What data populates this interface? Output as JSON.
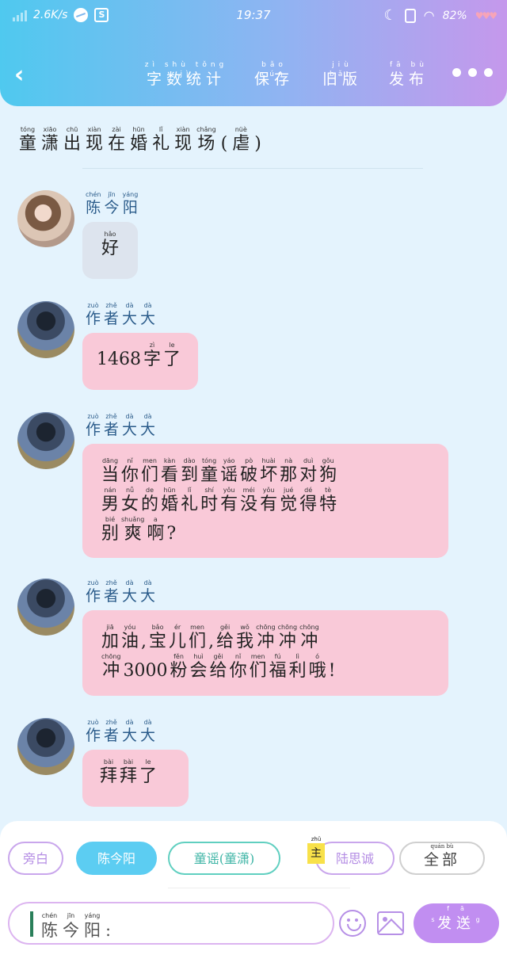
{
  "status_bar": {
    "speed": "2.6K/s",
    "s_icon": "S",
    "time": "19:37",
    "battery": "82%",
    "hearts": "♥♥♥"
  },
  "toolbar": {
    "back_icon": "‹",
    "items": [
      {
        "pinyin": "zì shù tǒng jì",
        "label": "字数统计"
      },
      {
        "pinyin": "bǎo cún",
        "label": "保存"
      },
      {
        "pinyin": "jiù bǎn",
        "label": "旧版"
      },
      {
        "pinyin": "fā bù",
        "label": "发布"
      }
    ]
  },
  "title": {
    "chars": [
      {
        "py": "tóng",
        "hz": "童"
      },
      {
        "py": "xiāo",
        "hz": "潇"
      },
      {
        "py": "chū",
        "hz": "出"
      },
      {
        "py": "xiàn",
        "hz": "现"
      },
      {
        "py": "zài",
        "hz": "在"
      },
      {
        "py": "hūn",
        "hz": "婚"
      },
      {
        "py": "lǐ",
        "hz": "礼"
      },
      {
        "py": "xiàn",
        "hz": "现"
      },
      {
        "py": "chǎng",
        "hz": "场"
      },
      {
        "py": "",
        "hz": "("
      },
      {
        "py": "nüè",
        "hz": "虐"
      },
      {
        "py": "",
        "hz": ")"
      }
    ]
  },
  "messages": [
    {
      "sender": [
        {
          "py": "chén",
          "hz": "陈"
        },
        {
          "py": "jīn",
          "hz": "今"
        },
        {
          "py": "yáng",
          "hz": "阳"
        }
      ],
      "lines": [
        [
          {
            "py": "hǎo",
            "hz": "好"
          }
        ]
      ]
    },
    {
      "sender": [
        {
          "py": "zuò",
          "hz": "作"
        },
        {
          "py": "zhě",
          "hz": "者"
        },
        {
          "py": "dà",
          "hz": "大"
        },
        {
          "py": "dà",
          "hz": "大"
        }
      ],
      "lines": [
        [
          {
            "py": "",
            "hz": "1468"
          },
          {
            "py": "zì",
            "hz": "字"
          },
          {
            "py": "le",
            "hz": "了"
          }
        ]
      ]
    },
    {
      "sender": [
        {
          "py": "zuò",
          "hz": "作"
        },
        {
          "py": "zhě",
          "hz": "者"
        },
        {
          "py": "dà",
          "hz": "大"
        },
        {
          "py": "dà",
          "hz": "大"
        }
      ],
      "lines": [
        [
          {
            "py": "dāng",
            "hz": "当"
          },
          {
            "py": "nǐ",
            "hz": "你"
          },
          {
            "py": "men",
            "hz": "们"
          },
          {
            "py": "kàn",
            "hz": "看"
          },
          {
            "py": "dào",
            "hz": "到"
          },
          {
            "py": "tóng",
            "hz": "童"
          },
          {
            "py": "yáo",
            "hz": "谣"
          },
          {
            "py": "pò",
            "hz": "破"
          },
          {
            "py": "huài",
            "hz": "坏"
          },
          {
            "py": "nà",
            "hz": "那"
          },
          {
            "py": "duì",
            "hz": "对"
          },
          {
            "py": "gǒu",
            "hz": "狗"
          }
        ],
        [
          {
            "py": "nán",
            "hz": "男"
          },
          {
            "py": "nǚ",
            "hz": "女"
          },
          {
            "py": "de",
            "hz": "的"
          },
          {
            "py": "hūn",
            "hz": "婚"
          },
          {
            "py": "lǐ",
            "hz": "礼"
          },
          {
            "py": "shí",
            "hz": "时"
          },
          {
            "py": "yǒu",
            "hz": "有"
          },
          {
            "py": "méi",
            "hz": "没"
          },
          {
            "py": "yǒu",
            "hz": "有"
          },
          {
            "py": "jué",
            "hz": "觉"
          },
          {
            "py": "dé",
            "hz": "得"
          },
          {
            "py": "tè",
            "hz": "特"
          }
        ],
        [
          {
            "py": "bié",
            "hz": "别"
          },
          {
            "py": "shuǎng",
            "hz": "爽"
          },
          {
            "py": "a",
            "hz": "啊"
          },
          {
            "py": "",
            "hz": "?"
          }
        ]
      ]
    },
    {
      "sender": [
        {
          "py": "zuò",
          "hz": "作"
        },
        {
          "py": "zhě",
          "hz": "者"
        },
        {
          "py": "dà",
          "hz": "大"
        },
        {
          "py": "dà",
          "hz": "大"
        }
      ],
      "lines": [
        [
          {
            "py": "jiā",
            "hz": "加"
          },
          {
            "py": "yóu",
            "hz": "油"
          },
          {
            "py": "",
            "hz": ","
          },
          {
            "py": "bǎo",
            "hz": "宝"
          },
          {
            "py": "ér",
            "hz": "儿"
          },
          {
            "py": "men",
            "hz": "们"
          },
          {
            "py": "",
            "hz": ","
          },
          {
            "py": "gěi",
            "hz": "给"
          },
          {
            "py": "wǒ",
            "hz": "我"
          },
          {
            "py": "chōng",
            "hz": "冲"
          },
          {
            "py": "chōng",
            "hz": "冲"
          },
          {
            "py": "chōng",
            "hz": "冲"
          }
        ],
        [
          {
            "py": "chōng",
            "hz": "冲"
          },
          {
            "py": "",
            "hz": "3000"
          },
          {
            "py": "fěn",
            "hz": "粉"
          },
          {
            "py": "huì",
            "hz": "会"
          },
          {
            "py": "gěi",
            "hz": "给"
          },
          {
            "py": "nǐ",
            "hz": "你"
          },
          {
            "py": "men",
            "hz": "们"
          },
          {
            "py": "fú",
            "hz": "福"
          },
          {
            "py": "lì",
            "hz": "利"
          },
          {
            "py": "ó",
            "hz": "哦"
          },
          {
            "py": "",
            "hz": "!"
          }
        ]
      ]
    },
    {
      "sender": [
        {
          "py": "zuò",
          "hz": "作"
        },
        {
          "py": "zhě",
          "hz": "者"
        },
        {
          "py": "dà",
          "hz": "大"
        },
        {
          "py": "dà",
          "hz": "大"
        }
      ],
      "lines": [
        [
          {
            "py": "bài",
            "hz": "拜"
          },
          {
            "py": "bài",
            "hz": "拜"
          },
          {
            "py": "le",
            "hz": "了"
          }
        ]
      ]
    }
  ],
  "roles": {
    "aside": "旁白",
    "chen": "陈今阳",
    "tong": "童谣(童潇)",
    "lu": "陆思诚",
    "lu_badge_py": "zhǔ",
    "lu_badge": "主",
    "all_py": "quán bù",
    "all": "全部"
  },
  "input": {
    "prefix": [
      {
        "py": "chén",
        "hz": "陈"
      },
      {
        "py": "jīn",
        "hz": "今"
      },
      {
        "py": "yáng",
        "hz": "阳"
      },
      {
        "py": "",
        "hz": ":"
      }
    ]
  },
  "send": {
    "pinyin": "fā sòng",
    "label": "发送"
  },
  "colors": {
    "header_start": "#4fc9ef",
    "header_end": "#c598ec",
    "bubble_pink": "#f9c9d8",
    "bubble_gray": "#dde4ee",
    "send_button": "#c18ef1"
  }
}
